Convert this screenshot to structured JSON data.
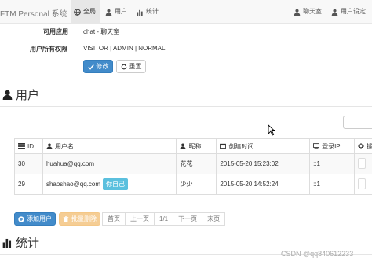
{
  "navbar": {
    "brand": "FTM Personal 系统",
    "items": [
      {
        "label": "全局",
        "icon": "globe-icon",
        "active": true
      },
      {
        "label": "用户",
        "icon": "user-icon",
        "active": false
      },
      {
        "label": "统计",
        "icon": "bar-chart-icon",
        "active": false
      }
    ],
    "right_items": [
      {
        "label": "聊天室",
        "icon": "user-icon"
      },
      {
        "label": "用户设定",
        "icon": "user-icon"
      }
    ]
  },
  "permissions": {
    "app_label": "可用应用",
    "app_value": "chat - 聊天室 |",
    "perm_label": "用户所有权限",
    "perm_value": "VISITOR | ADMIN | NORMAL",
    "edit_button": "修改",
    "reset_button": "重置"
  },
  "users_section": {
    "title": "用户",
    "columns": [
      "ID",
      "用户名",
      "昵称",
      "创建时间",
      "登录IP",
      "操"
    ],
    "rows": [
      {
        "id": "30",
        "username": "huahua@qq.com",
        "badge": "",
        "nickname": "花花",
        "created": "2015-05-20 15:23:02",
        "ip": "::1"
      },
      {
        "id": "29",
        "username": "shaoshao@qq.com",
        "badge": "你自己",
        "nickname": "少少",
        "created": "2015-05-20 14:52:24",
        "ip": "::1"
      }
    ],
    "add_button": "添加用户",
    "batch_delete_button": "批量删除",
    "pager": [
      "首页",
      "上一页",
      "1/1",
      "下一页",
      "末页"
    ]
  },
  "stats_section": {
    "title": "统计"
  },
  "watermark": "CSDN @qq840612233"
}
